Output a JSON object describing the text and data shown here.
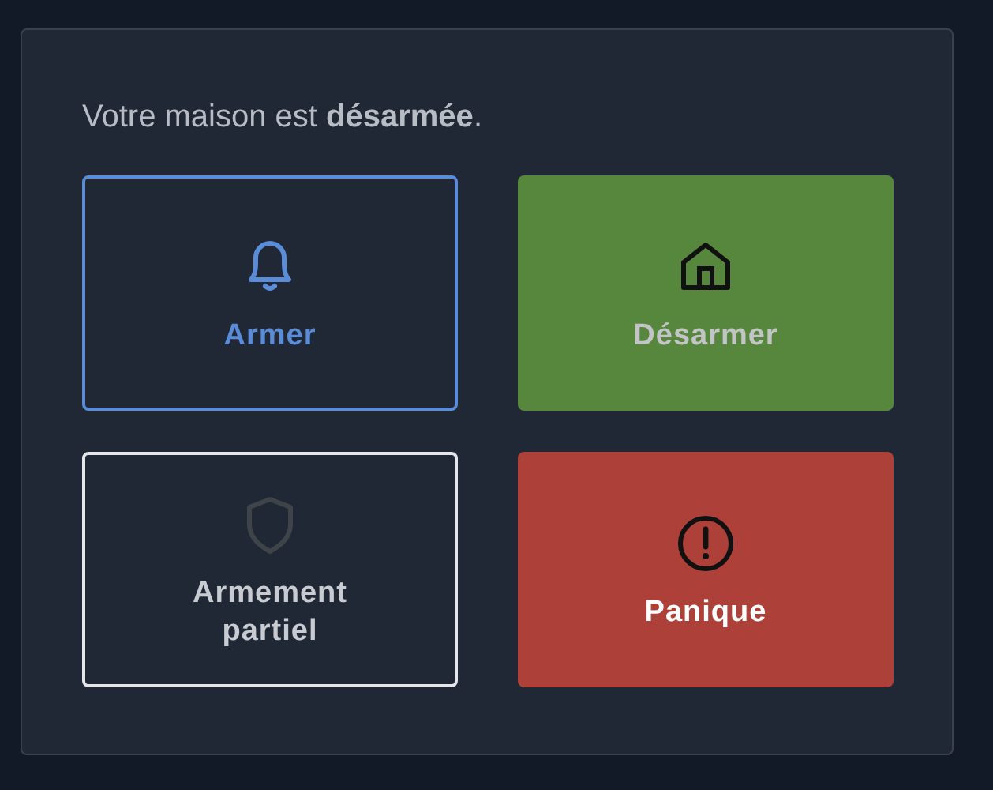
{
  "status_message": "Votre maison est **désarmée**.",
  "actions": [
    {
      "label": "Armer",
      "kind": "outline",
      "color": "#5b8cd8"
    },
    {
      "label": "Désarmer",
      "kind": "filled",
      "color": "#56873c"
    },
    {
      "label": "Armement partiel",
      "kind": "outline",
      "color": "#e4e6ea"
    },
    {
      "label": "Panique",
      "kind": "filled",
      "color": "#ad4139"
    }
  ]
}
